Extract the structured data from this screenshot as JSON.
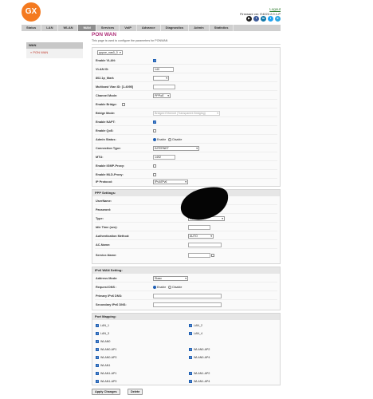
{
  "header": {
    "logo_text": "GX",
    "logout": "Logout",
    "firmware": "Firmware ver. E4222.2.0.1-P",
    "social_icons": [
      "youtube-icon",
      "facebook-icon",
      "linkedin-icon",
      "twitter-icon",
      "telegram-icon"
    ],
    "social_colors": [
      "#222222",
      "#3b5998",
      "#0e76a8",
      "#1da1f2",
      "#2ca5e0"
    ]
  },
  "nav": {
    "tabs": [
      "Status",
      "LAN",
      "WLAN",
      "WAN",
      "Services",
      "VoIP",
      "Advance",
      "Diagnostics",
      "Admin",
      "Statistics"
    ],
    "active": "WAN"
  },
  "sidebar": {
    "heading": "WAN",
    "items": [
      "» PON WAN"
    ]
  },
  "page": {
    "title": "PON WAN",
    "description": "This page is used to configure the parameters for PONWAN"
  },
  "wan": {
    "connection": "pppoe_nas0_0",
    "enable_vlan_label": "Enable VLAN:",
    "vlan_id_label": "VLAN ID:",
    "vlan_id": "140",
    "p8021_label": "802.1p_Mark",
    "multicast_label": "Multicast Vlan ID: [1-4095]",
    "channel_mode_label": "Channel Mode:",
    "channel_mode": "PPPoE",
    "enable_bridge_label": "Enable Bridge:",
    "bridge_mode_label": "Bridge Mode:",
    "bridge_mode": "Bridged Ethernet (Transparent Bridging)",
    "enable_napt_label": "Enable NAPT:",
    "enable_qos_label": "Enable QoS:",
    "admin_status_label": "Admin Status:",
    "enable_text": "Enable",
    "disable_text": "Disable",
    "conn_type_label": "Connection Type:",
    "conn_type": "INTERNET",
    "mtu_label": "MTU:",
    "mtu": "1492",
    "igmp_label": "Enable IGMP-Proxy:",
    "mld_label": "Enable MLD-Proxy:",
    "ip_protocol_label": "IP Protocol:",
    "ip_protocol": "IPv4/IPv6"
  },
  "ppp": {
    "heading": "PPP Settings:",
    "username_label": "UserName:",
    "password_label": "Password:",
    "type_label": "Type:",
    "type": "Continuous",
    "idle_label": "Idle Time (sec):",
    "auth_label": "Authentication Method:",
    "auth": "AUTO",
    "ac_label": "AC-Name:",
    "service_label": "Service-Name:"
  },
  "ipv6": {
    "heading": "IPv6 WAN Setting:",
    "addr_mode_label": "Address Mode:",
    "addr_mode": "Slaac",
    "req_dns_label": "Request DNS :",
    "primary_label": "Primary IPv6 DNS:",
    "secondary_label": "Secondary IPv6 DNS:"
  },
  "port_mapping": {
    "heading": "Port Mapping:",
    "ports": [
      {
        "label": "LAN_1",
        "checked": true
      },
      {
        "label": "LAN_2",
        "checked": true
      },
      {
        "label": "LAN_3",
        "checked": true
      },
      {
        "label": "LAN_4",
        "checked": true
      },
      {
        "label": "WLAN0",
        "checked": true
      },
      {
        "label": "WLAN0-AP1",
        "checked": true
      },
      {
        "label": "WLAN0-AP2",
        "checked": true
      },
      {
        "label": "WLAN0-AP3",
        "checked": true
      },
      {
        "label": "WLAN0-AP4",
        "checked": true
      },
      {
        "label": "WLAN1",
        "checked": true
      },
      {
        "label": "WLAN1-AP1",
        "checked": true
      },
      {
        "label": "WLAN1-AP2",
        "checked": true
      },
      {
        "label": "WLAN1-AP3",
        "checked": true
      },
      {
        "label": "WLAN1-AP4",
        "checked": true
      }
    ]
  },
  "buttons": {
    "apply": "Apply Changes",
    "delete": "Delete"
  }
}
